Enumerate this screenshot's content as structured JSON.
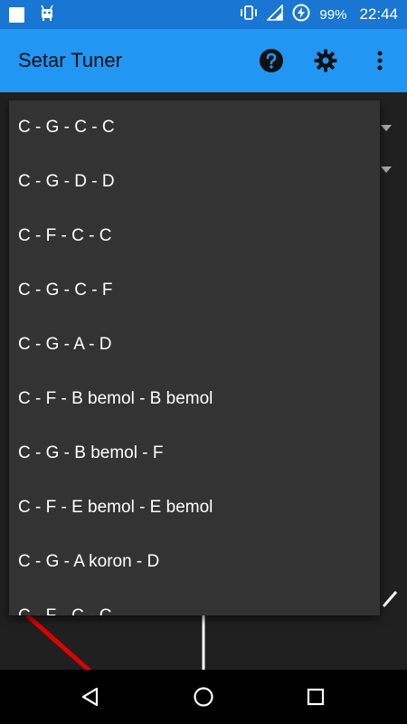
{
  "status_bar": {
    "battery": "99%",
    "time": "22:44",
    "icons": [
      "notification-square-icon",
      "android-debug-icon",
      "vibrate-icon",
      "signal-icon",
      "battery-saver-icon"
    ]
  },
  "app_bar": {
    "title": "Setar Tuner",
    "actions": [
      "help-icon",
      "settings-icon",
      "overflow-menu-icon"
    ],
    "color": "#2196f3"
  },
  "tuning_dropdown": {
    "items": [
      "C - G - C - C",
      "C - G - D - D",
      "C - F - C - C",
      "C - G - C - F",
      "C - G - A - D",
      "C - F - B bemol - B bemol",
      "C - G - B bemol - F",
      "C - F - E bemol - E bemol",
      "C - G - A koron - D",
      "C - F - C - C"
    ]
  },
  "nav_bar": {
    "buttons": [
      "back-icon",
      "home-icon",
      "recents-icon"
    ]
  },
  "colors": {
    "status_bar": "#1976d2",
    "dropdown_bg": "#333333",
    "needle": "#e00000",
    "text": "#ffffff"
  }
}
